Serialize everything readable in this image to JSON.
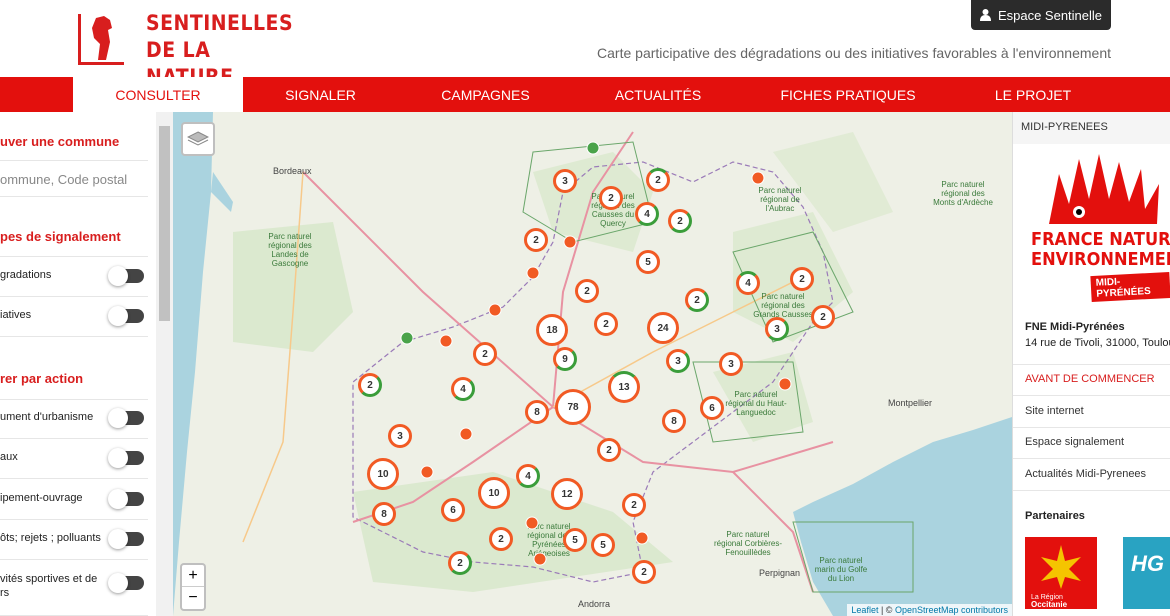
{
  "header": {
    "logo_line1": "SENTINELLES",
    "logo_line2": "DE LA NATURE",
    "espace_button": "Espace Sentinelle",
    "tagline": "Carte participative des dégradations ou des initiatives favorables à l'environnement"
  },
  "nav": [
    {
      "label": "CONSULTER",
      "active": true
    },
    {
      "label": "SIGNALER",
      "active": false
    },
    {
      "label": "CAMPAGNES",
      "active": false
    },
    {
      "label": "ACTUALITÉS",
      "active": false
    },
    {
      "label": "FICHES PRATIQUES",
      "active": false
    },
    {
      "label": "LE PROJET",
      "active": false
    }
  ],
  "sidebar": {
    "commune_title": "uver une commune",
    "commune_placeholder": "ommune, Code postal",
    "types_title": "pes de signalement",
    "types": [
      "gradations",
      "iatives"
    ],
    "action_title": "rer par action",
    "actions": [
      "ument d'urbanisme",
      "aux",
      "ipement-ouvrage",
      "ôts; rejets ; polluants",
      "vités sportives et de\nrs"
    ]
  },
  "map": {
    "clusters": [
      {
        "n": "3"
      },
      {
        "n": "2"
      },
      {
        "n": "2"
      },
      {
        "n": "4"
      },
      {
        "n": "2"
      },
      {
        "n": "2"
      },
      {
        "n": "5"
      },
      {
        "n": "4"
      },
      {
        "n": "2"
      },
      {
        "n": "2"
      },
      {
        "n": "2"
      },
      {
        "n": "2"
      },
      {
        "n": "18"
      },
      {
        "n": "2"
      },
      {
        "n": "24"
      },
      {
        "n": "3"
      },
      {
        "n": "2"
      },
      {
        "n": "9"
      },
      {
        "n": "3"
      },
      {
        "n": "3"
      },
      {
        "n": "2"
      },
      {
        "n": "4"
      },
      {
        "n": "13"
      },
      {
        "n": "78"
      },
      {
        "n": "8"
      },
      {
        "n": "8"
      },
      {
        "n": "6"
      },
      {
        "n": "3"
      },
      {
        "n": "2"
      },
      {
        "n": "10"
      },
      {
        "n": "4"
      },
      {
        "n": "10"
      },
      {
        "n": "12"
      },
      {
        "n": "2"
      },
      {
        "n": "8"
      },
      {
        "n": "6"
      },
      {
        "n": "2"
      },
      {
        "n": "5"
      },
      {
        "n": "5"
      },
      {
        "n": "2"
      },
      {
        "n": "2"
      }
    ],
    "labels": {
      "bordeaux": "Bordeaux",
      "montpellier": "Montpellier",
      "perpignan": "Perpignan",
      "andorra": "Andorra",
      "parc1": "Parc naturel régional des Landes de Gascogne",
      "parc2": "Parc naturel régional des Causses du Quercy",
      "parc3": "Parc naturel régional des Grands Causses",
      "parc4": "Parc naturel régional du Haut-Languedoc",
      "parc5": "Parc naturel régional des Pyrénées Ariégeoises",
      "parc6": "Parc naturel régional des Monts d'Ardèche",
      "parc7": "Parc naturel régional de l'Aubrac",
      "parc8": "Parc naturel marin du Golfe du Lion",
      "parc9": "Parc naturel régional Corbières-Fenouillèdes"
    },
    "zoom_in": "+",
    "zoom_out": "−",
    "attribution_leaflet": "Leaflet",
    "attribution_sep": " | © ",
    "attribution_osm": "OpenStreetMap contributors"
  },
  "rpanel": {
    "region": "MIDI-PYRENEES",
    "fne_line1": "FRANCE NATURE",
    "fne_line2": "ENVIRONNEMENT",
    "fne_badge": "MIDI-PYRÉNÉES",
    "org_name": "FNE Midi-Pyrénées",
    "org_address": "14 rue de Tivoli, 31000, Toulou",
    "links": [
      "AVANT DE COMMENCER",
      "Site internet",
      "Espace signalement",
      "Actualités Midi-Pyrenees"
    ],
    "partners": "Partenaires",
    "region_logo_line1": "La Région",
    "region_logo_line2": "Occitanie",
    "hg_logo": "HG"
  }
}
